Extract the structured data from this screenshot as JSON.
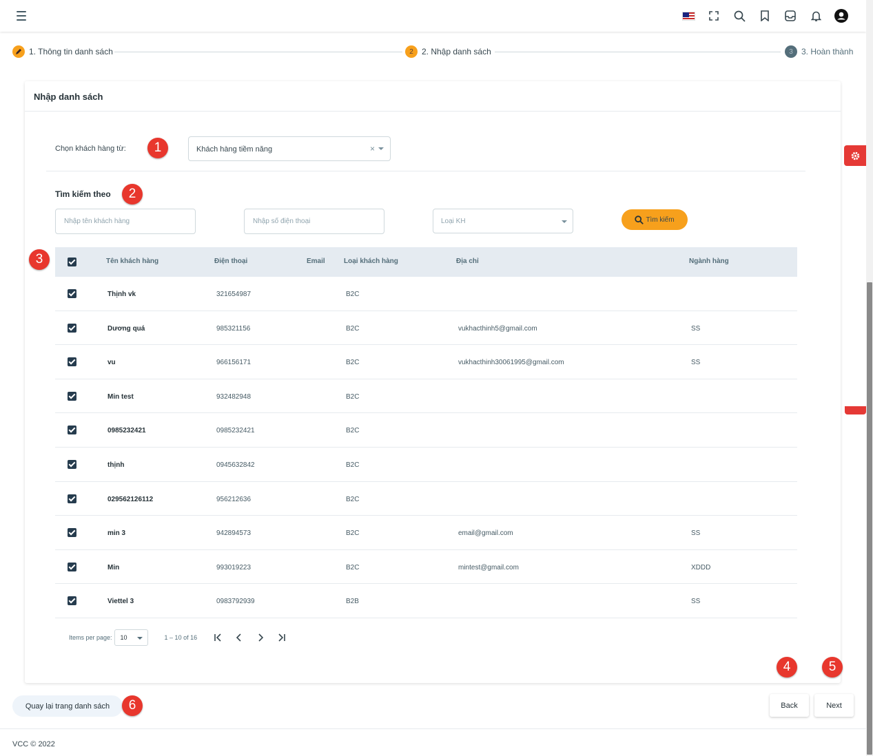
{
  "header": {
    "icons": [
      "menu-icon",
      "us-flag-icon",
      "fullscreen-icon",
      "search-icon",
      "bookmark-icon",
      "inbox-icon",
      "bell-icon",
      "user-icon"
    ]
  },
  "stepper": {
    "steps": [
      {
        "label": "1. Thông tin danh sách",
        "status": "done"
      },
      {
        "label": "2. Nhập danh sách",
        "number": "2",
        "status": "active"
      },
      {
        "label": "3. Hoàn thành",
        "number": "3",
        "status": "pending"
      }
    ]
  },
  "card": {
    "title": "Nhập danh sách",
    "source_label": "Chọn khách hàng từ:",
    "source_value": "Khách hàng tiềm năng",
    "clear_symbol": "×",
    "search_heading": "Tìm kiếm theo",
    "name_placeholder": "Nhập tên khách hàng",
    "phone_placeholder": "Nhập số điện thoại",
    "type_placeholder": "Loại KH",
    "search_button": "Tìm kiếm"
  },
  "table": {
    "columns": [
      "Tên khách hàng",
      "Điện thoại",
      "Email",
      "Loại khách hàng",
      "Địa chỉ",
      "Ngành hàng"
    ],
    "rows": [
      {
        "name": "Thịnh vk",
        "phone": "321654987",
        "email": "",
        "type": "B2C",
        "address": "",
        "industry": ""
      },
      {
        "name": "Dương quá",
        "phone": "985321156",
        "email": "",
        "type": "B2C",
        "address": "vukhacthinh5@gmail.com",
        "industry": "SS"
      },
      {
        "name": "vu",
        "phone": "966156171",
        "email": "",
        "type": "B2C",
        "address": "vukhacthinh30061995@gmail.com",
        "industry": "SS"
      },
      {
        "name": "Min test",
        "phone": "932482948",
        "email": "",
        "type": "B2C",
        "address": "",
        "industry": ""
      },
      {
        "name": "0985232421",
        "phone": "0985232421",
        "email": "",
        "type": "B2C",
        "address": "",
        "industry": ""
      },
      {
        "name": "thịnh",
        "phone": "0945632842",
        "email": "",
        "type": "B2C",
        "address": "",
        "industry": ""
      },
      {
        "name": "029562126112",
        "phone": "956212636",
        "email": "",
        "type": "B2C",
        "address": "",
        "industry": ""
      },
      {
        "name": "min 3",
        "phone": "942894573",
        "email": "",
        "type": "B2C",
        "address": "email@gmail.com",
        "industry": "SS"
      },
      {
        "name": "Min",
        "phone": "993019223",
        "email": "",
        "type": "B2C",
        "address": "mintest@gmail.com",
        "industry": "XDDD"
      },
      {
        "name": "Viettel 3",
        "phone": "0983792939",
        "email": "",
        "type": "B2B",
        "address": "",
        "industry": "SS"
      }
    ]
  },
  "paginator": {
    "items_per_page_label": "Items per page:",
    "page_size": "10",
    "range": "1 – 10 of 16"
  },
  "actions": {
    "back_to_list": "Quay lại trang danh sách",
    "back": "Back",
    "next": "Next"
  },
  "footer": {
    "text": "VCC © 2022"
  },
  "markers": [
    "1",
    "2",
    "3",
    "4",
    "5",
    "6"
  ],
  "colors": {
    "accent": "#f7a01c",
    "marker": "#e8372d",
    "table_header_bg": "#e5ebf1",
    "checkbox": "#263c4e",
    "gear_tab": "#e53935"
  }
}
